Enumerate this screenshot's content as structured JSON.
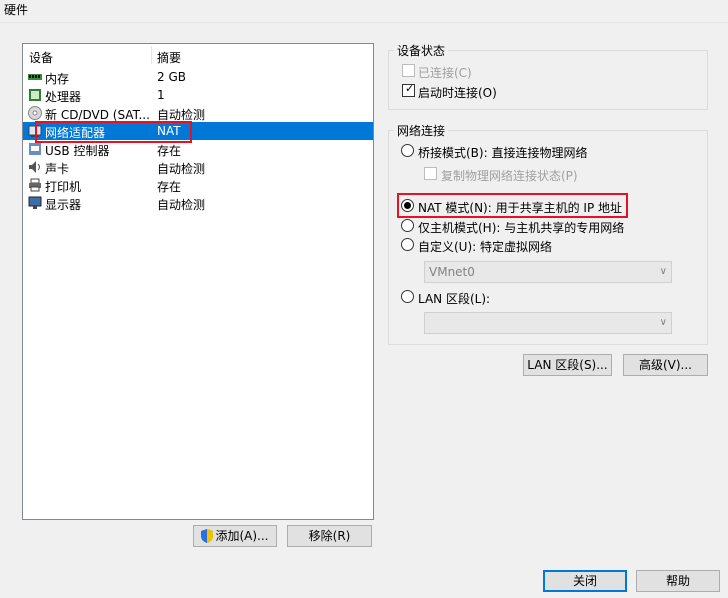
{
  "window": {
    "title": "硬件"
  },
  "device_list": {
    "col_device": "设备",
    "col_summary": "摘要",
    "rows": [
      {
        "name": "内存",
        "summary": "2 GB",
        "icon": "memory-icon"
      },
      {
        "name": "处理器",
        "summary": "1",
        "icon": "processor-icon"
      },
      {
        "name": "新 CD/DVD (SAT...",
        "summary": "自动检测",
        "icon": "cd-dvd-icon"
      },
      {
        "name": "网络适配器",
        "summary": "NAT",
        "icon": "network-adapter-icon"
      },
      {
        "name": "USB 控制器",
        "summary": "存在",
        "icon": "usb-icon"
      },
      {
        "name": "声卡",
        "summary": "自动检测",
        "icon": "sound-card-icon"
      },
      {
        "name": "打印机",
        "summary": "存在",
        "icon": "printer-icon"
      },
      {
        "name": "显示器",
        "summary": "自动检测",
        "icon": "display-icon"
      }
    ],
    "selected_row": "网络适配器"
  },
  "buttons": {
    "add": "添加(A)...",
    "remove": "移除(R)",
    "lan_segments": "LAN 区段(S)...",
    "advanced": "高级(V)...",
    "close": "关闭",
    "help": "帮助"
  },
  "device_status": {
    "title": "设备状态",
    "connected": {
      "label": "已连接(C)",
      "checked": false,
      "enabled": false
    },
    "connect_at_power_on": {
      "label": "启动时连接(O)",
      "checked": true,
      "enabled": true
    }
  },
  "network_connection": {
    "title": "网络连接",
    "bridged": "桥接模式(B): 直接连接物理网络",
    "replicate": "复制物理网络连接状态(P)",
    "nat": "NAT 模式(N): 用于共享主机的 IP 地址",
    "host_only": "仅主机模式(H): 与主机共享的专用网络",
    "custom": "自定义(U): 特定虚拟网络",
    "custom_value": "VMnet0",
    "lan_segment": "LAN 区段(L):",
    "lan_segment_value": "",
    "selected": "nat"
  },
  "colors": {
    "selection": "#0078d7",
    "highlight_box": "#e81123"
  }
}
